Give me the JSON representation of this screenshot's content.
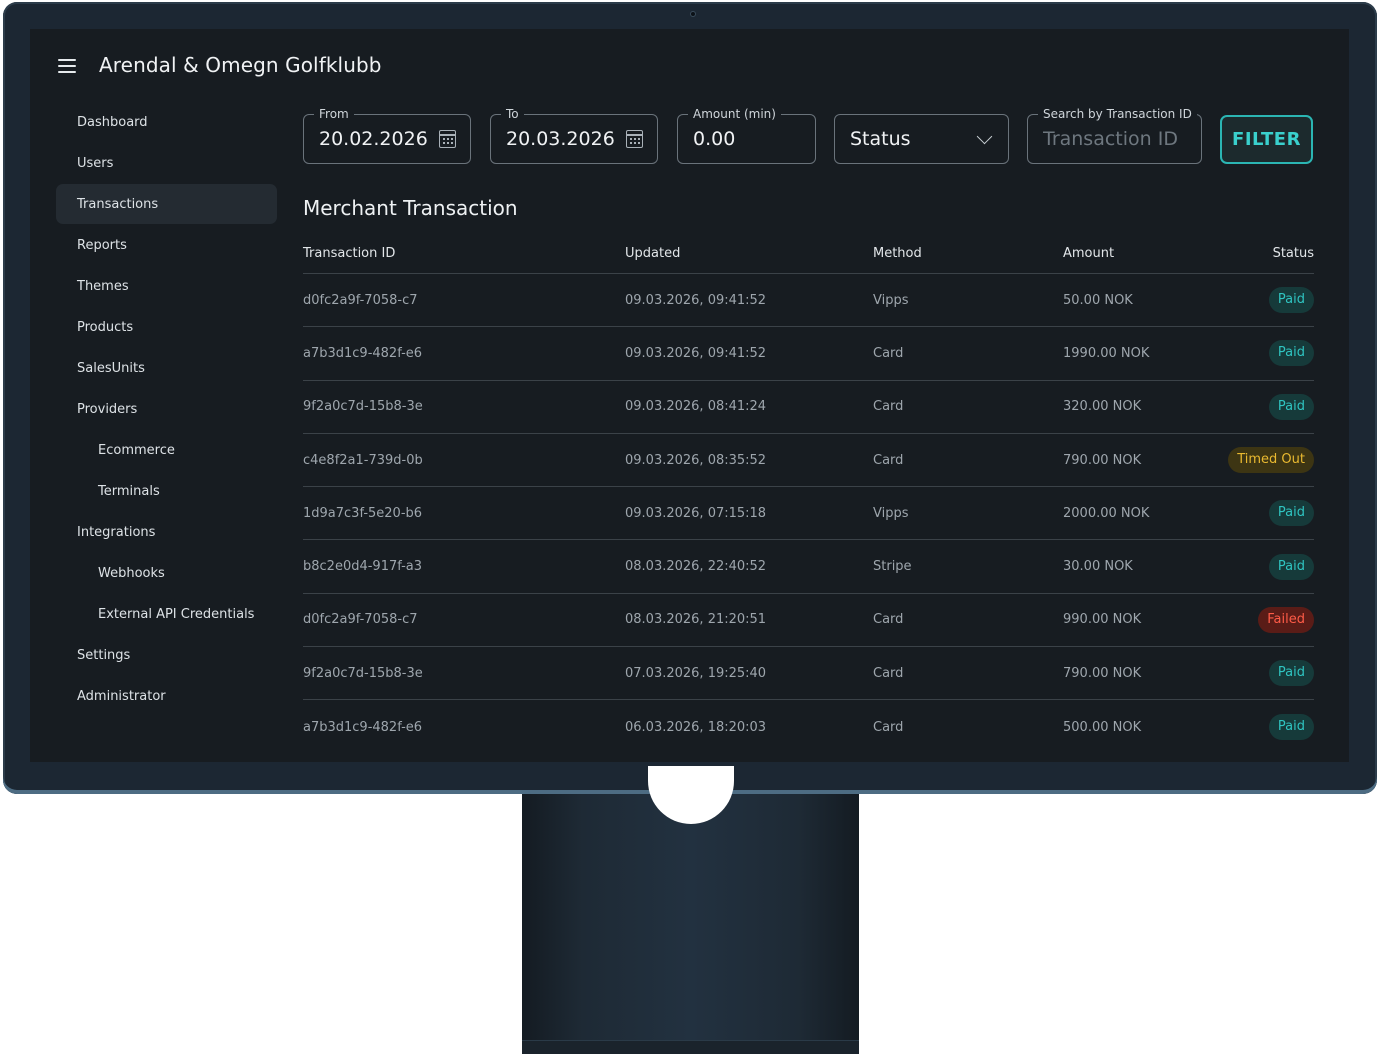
{
  "header": {
    "title": "Arendal & Omegn Golfklubb"
  },
  "sidebar": {
    "items": [
      {
        "label": "Dashboard",
        "active": false,
        "sub": false
      },
      {
        "label": "Users",
        "active": false,
        "sub": false
      },
      {
        "label": "Transactions",
        "active": true,
        "sub": false
      },
      {
        "label": "Reports",
        "active": false,
        "sub": false
      },
      {
        "label": "Themes",
        "active": false,
        "sub": false
      },
      {
        "label": "Products",
        "active": false,
        "sub": false
      },
      {
        "label": "SalesUnits",
        "active": false,
        "sub": false
      },
      {
        "label": "Providers",
        "active": false,
        "sub": false
      },
      {
        "label": "Ecommerce",
        "active": false,
        "sub": true
      },
      {
        "label": "Terminals",
        "active": false,
        "sub": true
      },
      {
        "label": "Integrations",
        "active": false,
        "sub": false
      },
      {
        "label": "Webhooks",
        "active": false,
        "sub": true
      },
      {
        "label": "External API Credentials",
        "active": false,
        "sub": true
      },
      {
        "label": "Settings",
        "active": false,
        "sub": false
      },
      {
        "label": "Administrator",
        "active": false,
        "sub": false
      }
    ]
  },
  "filters": {
    "from": {
      "label": "From",
      "value": "20.02.2026"
    },
    "to": {
      "label": "To",
      "value": "20.03.2026"
    },
    "amount": {
      "label": "Amount (min)",
      "value": "0.00"
    },
    "status": {
      "value": "Status"
    },
    "search": {
      "label": "Search by Transaction ID",
      "placeholder": "Transaction ID"
    },
    "filter_button": "FILTER"
  },
  "table": {
    "title": "Merchant Transaction",
    "columns": [
      "Transaction ID",
      "Updated",
      "Method",
      "Amount",
      "Status"
    ],
    "rows": [
      {
        "id": "d0fc2a9f-7058-c7",
        "updated": "09.03.2026, 09:41:52",
        "method": "Vipps",
        "amount": "50.00 NOK",
        "status": "Paid",
        "status_kind": "paid"
      },
      {
        "id": "a7b3d1c9-482f-e6",
        "updated": "09.03.2026, 09:41:52",
        "method": "Card",
        "amount": "1990.00 NOK",
        "status": "Paid",
        "status_kind": "paid"
      },
      {
        "id": "9f2a0c7d-15b8-3e",
        "updated": "09.03.2026, 08:41:24",
        "method": "Card",
        "amount": "320.00 NOK",
        "status": "Paid",
        "status_kind": "paid"
      },
      {
        "id": "c4e8f2a1-739d-0b",
        "updated": "09.03.2026, 08:35:52",
        "method": "Card",
        "amount": "790.00 NOK",
        "status": "Timed Out",
        "status_kind": "timed"
      },
      {
        "id": "1d9a7c3f-5e20-b6",
        "updated": "09.03.2026, 07:15:18",
        "method": "Vipps",
        "amount": "2000.00 NOK",
        "status": "Paid",
        "status_kind": "paid"
      },
      {
        "id": "b8c2e0d4-917f-a3",
        "updated": "08.03.2026, 22:40:52",
        "method": "Stripe",
        "amount": "30.00 NOK",
        "status": "Paid",
        "status_kind": "paid"
      },
      {
        "id": "d0fc2a9f-7058-c7",
        "updated": "08.03.2026, 21:20:51",
        "method": "Card",
        "amount": "990.00 NOK",
        "status": "Failed",
        "status_kind": "failed"
      },
      {
        "id": "9f2a0c7d-15b8-3e",
        "updated": "07.03.2026, 19:25:40",
        "method": "Card",
        "amount": "790.00 NOK",
        "status": "Paid",
        "status_kind": "paid"
      },
      {
        "id": "a7b3d1c9-482f-e6",
        "updated": "06.03.2026, 18:20:03",
        "method": "Card",
        "amount": "500.00 NOK",
        "status": "Paid",
        "status_kind": "paid"
      }
    ]
  },
  "colors": {
    "accent": "#2bb5b3",
    "background": "#171c21",
    "paid": "#2fc4c1",
    "timed_out": "#e9b930",
    "failed": "#ff5b47"
  }
}
